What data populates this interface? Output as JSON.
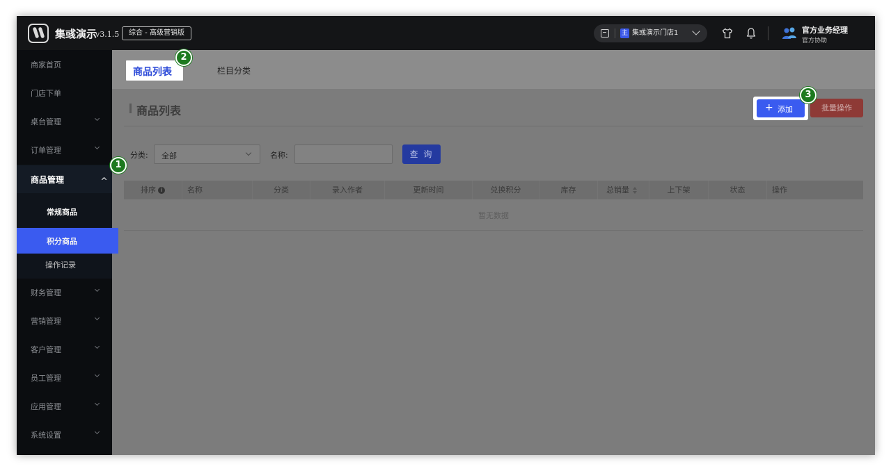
{
  "header": {
    "app_name": "集彧演示",
    "version": "v3.1.5",
    "edition": "综合 - 高级营销版",
    "store": {
      "tag": "主",
      "name": "集彧演示门店1"
    },
    "user": {
      "name": "官方业务经理",
      "role": "官方协助"
    }
  },
  "sidebar": {
    "items": [
      {
        "label": "商家首页"
      },
      {
        "label": "门店下单"
      },
      {
        "label": "桌台管理"
      },
      {
        "label": "订单管理"
      },
      {
        "label": "商品管理"
      },
      {
        "label": "财务管理"
      },
      {
        "label": "营销管理"
      },
      {
        "label": "客户管理"
      },
      {
        "label": "员工管理"
      },
      {
        "label": "应用管理"
      },
      {
        "label": "系统设置"
      }
    ],
    "sub_items": [
      {
        "label": "常规商品"
      },
      {
        "label": "积分商品"
      },
      {
        "label": "操作记录"
      }
    ]
  },
  "callouts": [
    "1",
    "2",
    "3"
  ],
  "tabs": [
    {
      "label": "商品列表"
    },
    {
      "label": "栏目分类"
    }
  ],
  "main": {
    "section_title": "商品列表",
    "add_button": "添加",
    "batch_button": "批量操作",
    "filters": {
      "category_label": "分类:",
      "category_value": "全部",
      "name_label": "名称:",
      "name_value": "",
      "query_button": "查 询"
    },
    "table": {
      "columns": [
        "排序",
        "名称",
        "分类",
        "录入作者",
        "更新时间",
        "兑换积分",
        "库存",
        "总销量",
        "上下架",
        "状态",
        "操作"
      ],
      "empty_text": "暂无数据"
    }
  },
  "colors": {
    "accent": "#3a5bf0",
    "sidebar_bg": "#0b0d10",
    "topbar_bg": "#141517",
    "callout": "#1d7a1f",
    "danger": "#c9453f"
  }
}
